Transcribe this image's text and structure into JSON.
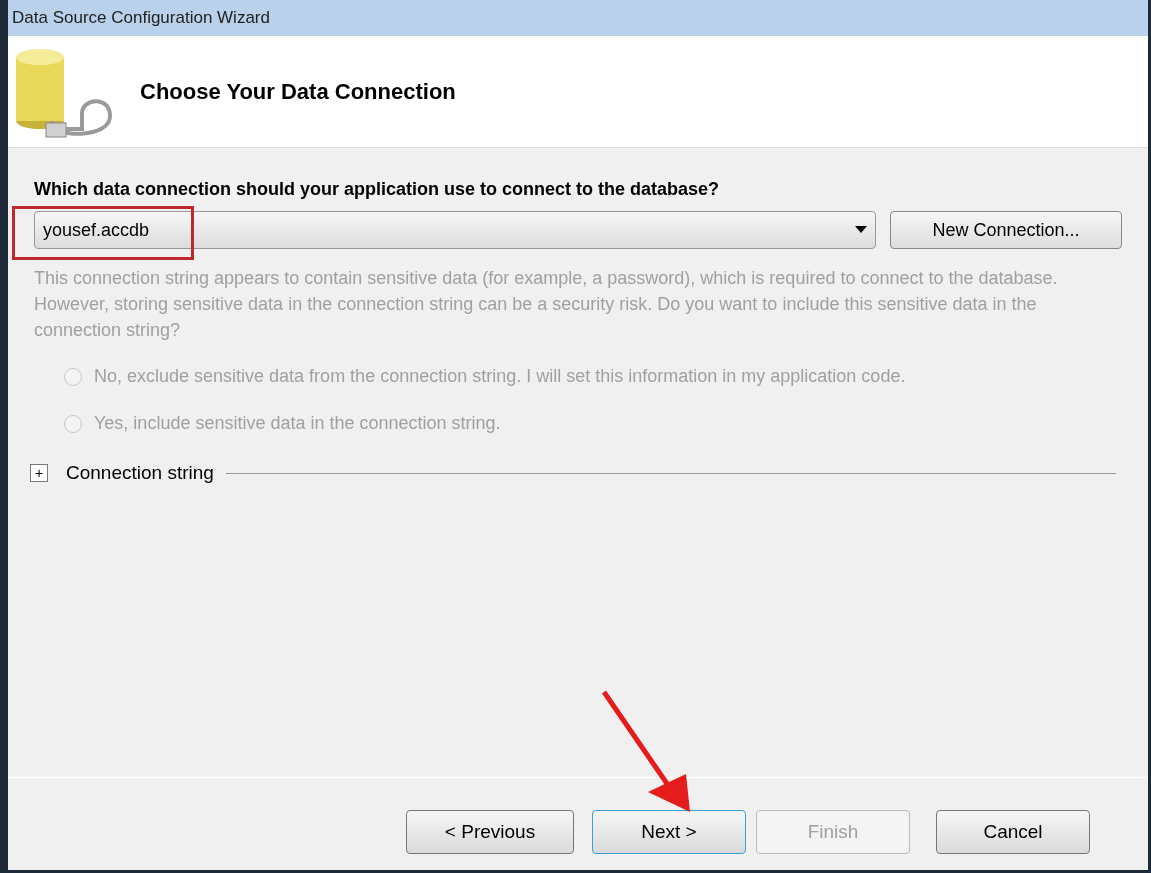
{
  "window": {
    "title": "Data Source Configuration Wizard"
  },
  "header": {
    "title": "Choose Your Data Connection"
  },
  "question": "Which data connection should your application use to connect to the database?",
  "connection_select": {
    "value": "yousef.accdb",
    "highlighted": true
  },
  "new_connection_button": "New Connection...",
  "sensitive_note": {
    "text": "This connection string appears to contain sensitive data (for example, a password), which is required to connect to the database. However, storing sensitive data in the connection string can be a security risk. Do you want to include this sensitive data in the connection string?",
    "disabled": true
  },
  "radios": [
    {
      "label": "No, exclude sensitive data from the connection string. I will set this information in my application code.",
      "selected": false,
      "disabled": true
    },
    {
      "label": "Yes, include sensitive data in the connection string.",
      "selected": false,
      "disabled": true
    }
  ],
  "connection_string": {
    "label": "Connection string",
    "expanded": false,
    "toggle": "+"
  },
  "buttons": [
    {
      "label": "< Previous",
      "disabled": false,
      "default": false
    },
    {
      "label": "Next >",
      "disabled": false,
      "default": true
    },
    {
      "label": "Finish",
      "disabled": true,
      "default": false
    },
    {
      "label": "Cancel",
      "disabled": false,
      "default": false
    }
  ]
}
